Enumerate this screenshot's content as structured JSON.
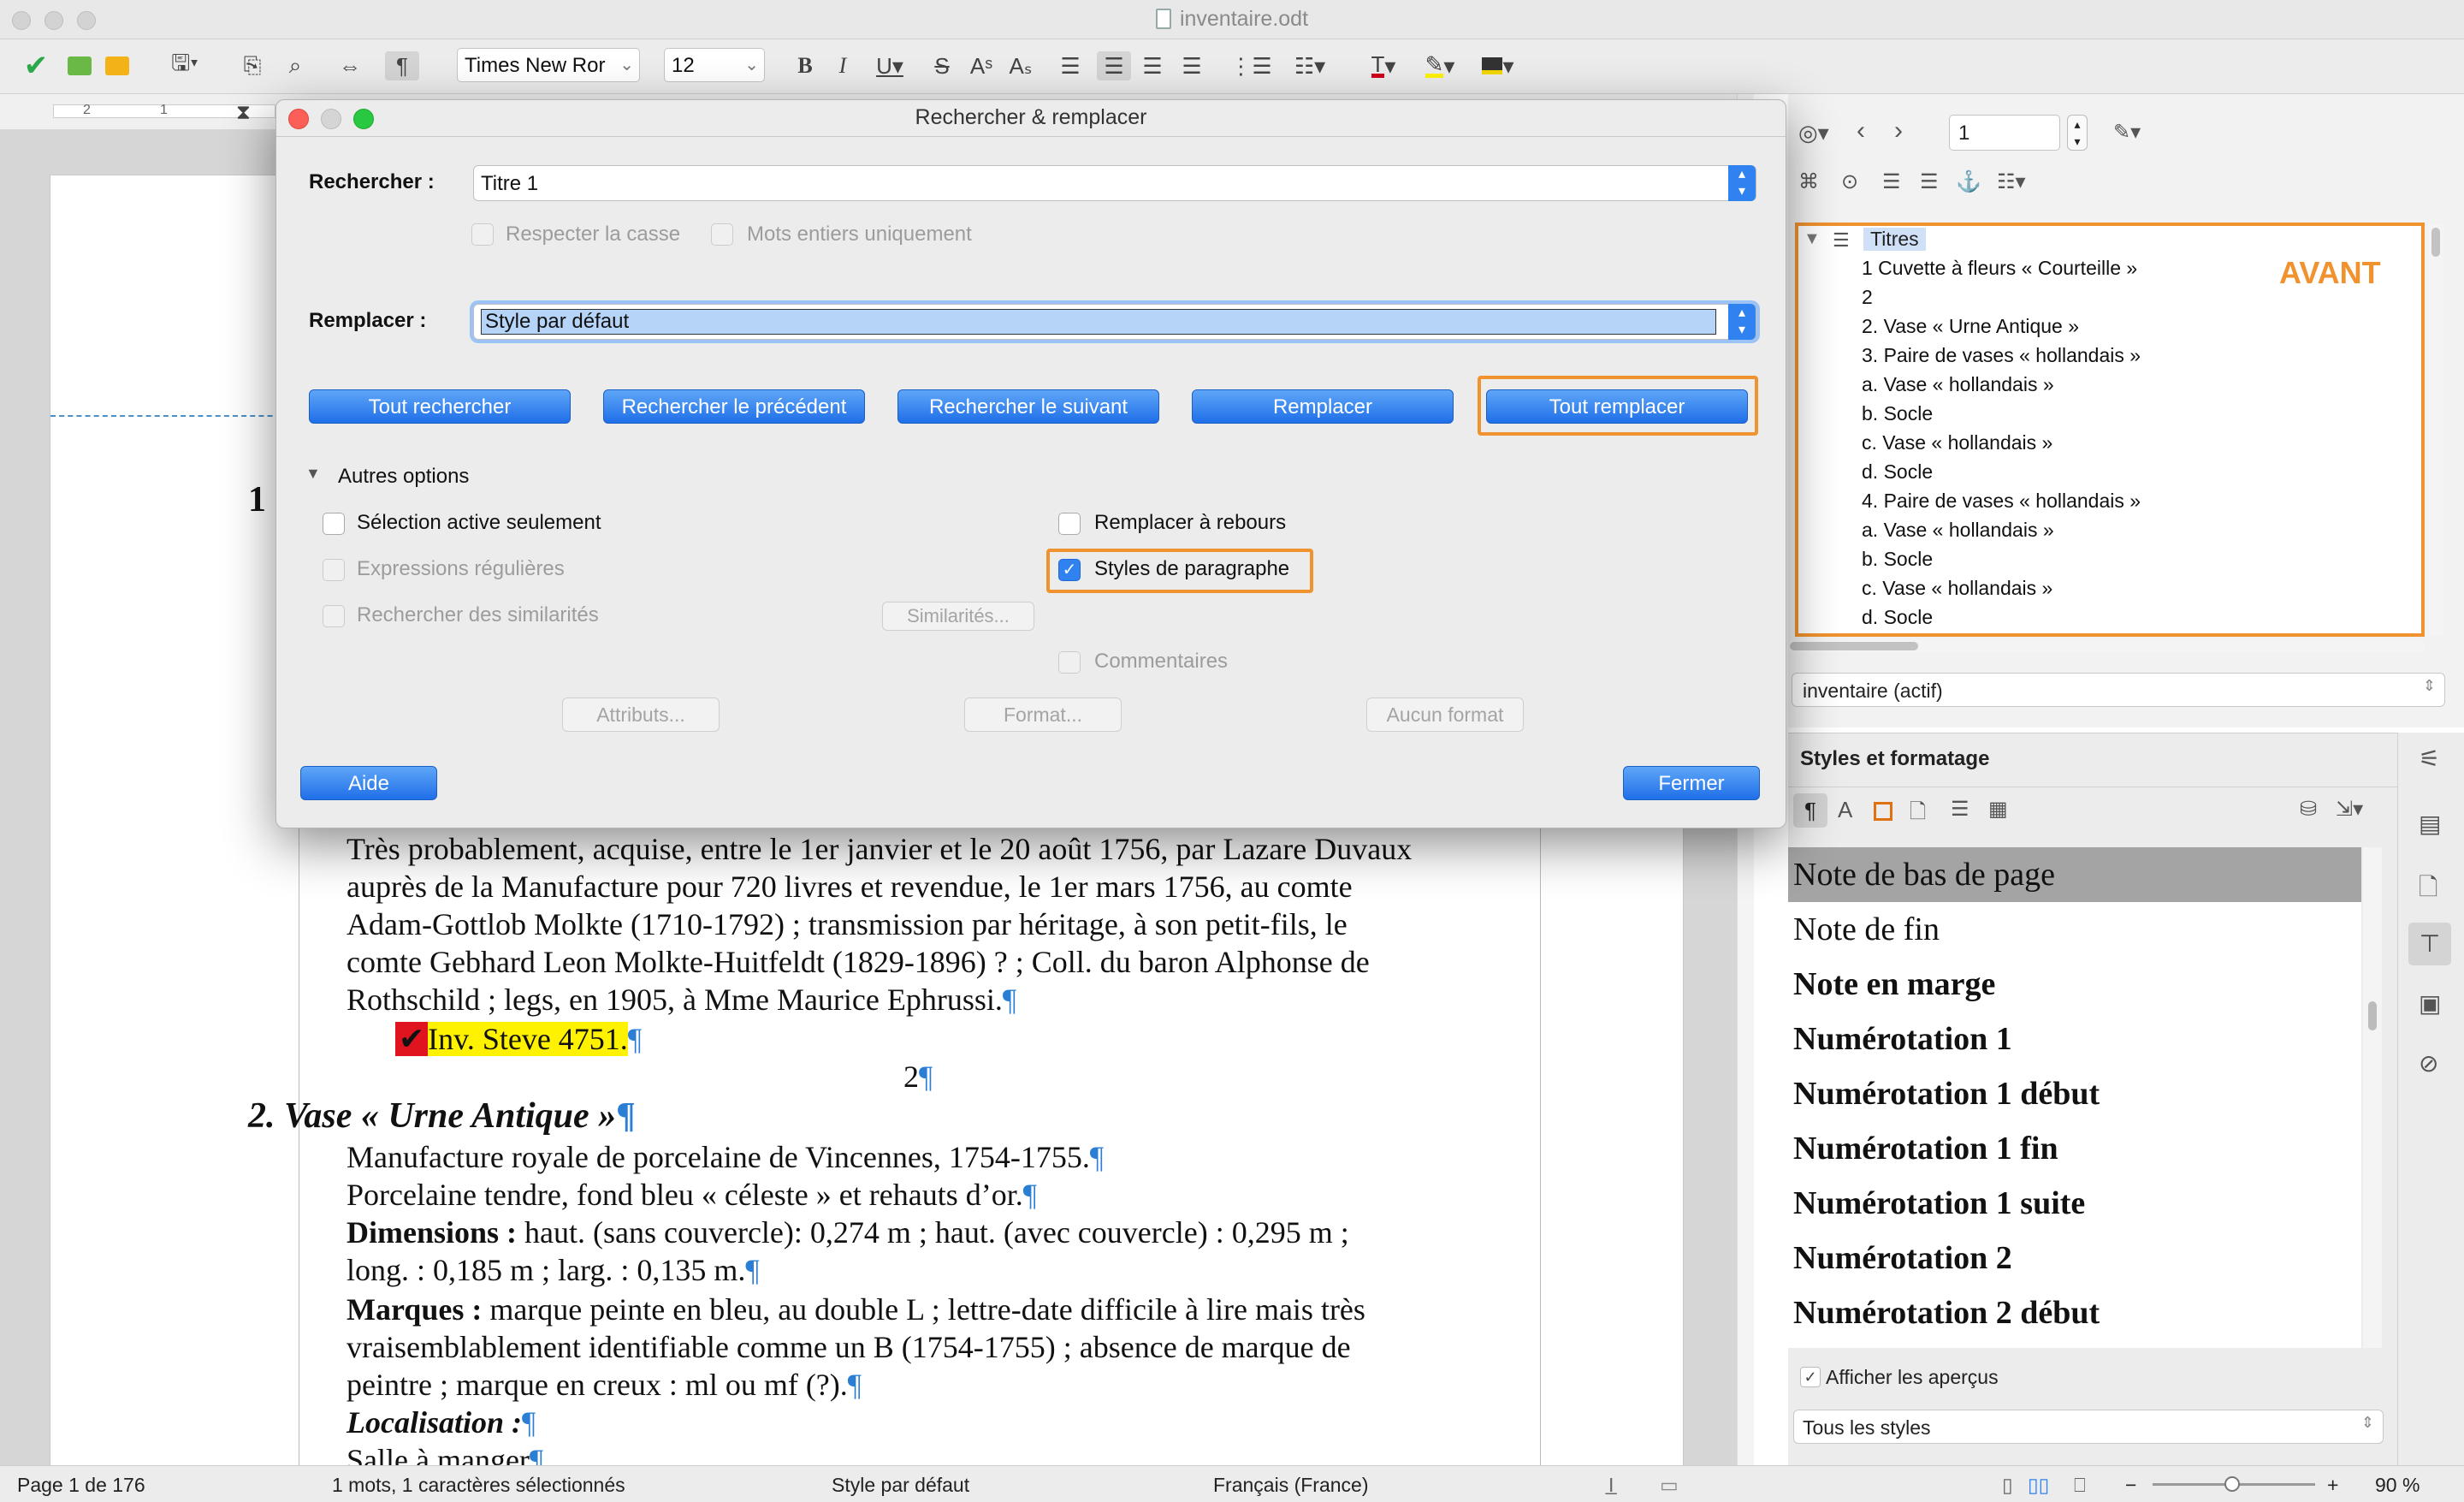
{
  "window": {
    "title": "inventaire.odt"
  },
  "toolbar": {
    "font_name": "Times New Ror",
    "font_size": "12"
  },
  "ruler": {
    "ticks": [
      "2",
      "1"
    ]
  },
  "document": {
    "heading1_number": "1",
    "para_lines": [
      "Très probablement, acquise, entre le 1er janvier et le 20 août 1756, par Lazare Duvaux",
      "auprès de la Manufacture pour 720 livres et revendue, le 1er mars 1756, au comte",
      "Adam-Gottlob Molkte (1710-1792) ; transmission par héritage, à son petit-fils, le",
      "comte Gebhard Leon Molkte-Huitfeldt (1829-1896) ? ; Coll. du baron Alphonse de",
      "Rothschild ; legs, en 1905, à Mme Maurice Ephrussi."
    ],
    "inv_note": "Inv. Steve 4751.",
    "center_number": "2",
    "heading2": "2. Vase « Urne Antique »",
    "lines2": [
      "Manufacture royale de porcelaine de Vincennes, 1754-1755.",
      "Porcelaine tendre, fond bleu « céleste » et rehauts d’or."
    ],
    "dimensions_label": "Dimensions :",
    "dimensions_text": " haut. (sans couvercle): 0,274 m ; haut. (avec couvercle) : 0,295 m ;",
    "dimensions_line2": "long. : 0,185 m ; larg. : 0,135 m.",
    "marques_label": "Marques :",
    "marques_text": " marque peinte en bleu, au double L ; lettre-date difficile à lire mais très",
    "marques_line2": "vraisemblablement identifiable comme un B (1754-1755) ; absence de marque de",
    "marques_line3": "peintre ; marque en creux : ml ou mf (?).",
    "localisation_label": "Localisation :",
    "last_line": "Salle à manger"
  },
  "statusbar": {
    "page": "Page 1 de 176",
    "selection": "1 mots, 1 caractères sélectionnés",
    "style": "Style par défaut",
    "language": "Français (France)",
    "zoom": "90 %"
  },
  "navigator": {
    "page_value": "1",
    "root": "Titres",
    "items": [
      "1 Cuvette à fleurs « Courteille »",
      "2",
      "2. Vase « Urne Antique »",
      "3. Paire de vases « hollandais »",
      "a. Vase « hollandais »",
      "b. Socle",
      "c. Vase « hollandais »",
      "d. Socle",
      "4. Paire de vases « hollandais »",
      "a. Vase « hollandais »",
      "b. Socle",
      "c. Vase « hollandais »",
      "d. Socle"
    ],
    "annotation": "AVANT",
    "document_select": "inventaire (actif)"
  },
  "styles_panel": {
    "title": "Styles et formatage",
    "styles": [
      {
        "name": "Note de bas de page",
        "bold": false,
        "selected": true
      },
      {
        "name": "Note de fin",
        "bold": false,
        "selected": false
      },
      {
        "name": "Note en marge",
        "bold": true,
        "selected": false
      },
      {
        "name": "Numérotation 1",
        "bold": true,
        "selected": false
      },
      {
        "name": "Numérotation 1 début",
        "bold": true,
        "selected": false
      },
      {
        "name": "Numérotation 1 fin",
        "bold": true,
        "selected": false
      },
      {
        "name": "Numérotation 1 suite",
        "bold": true,
        "selected": false
      },
      {
        "name": "Numérotation 2",
        "bold": true,
        "selected": false
      },
      {
        "name": "Numérotation 2 début",
        "bold": true,
        "selected": false
      }
    ],
    "show_previews": "Afficher les aperçus",
    "filter": "Tous les styles"
  },
  "dialog": {
    "title": "Rechercher & remplacer",
    "search_label": "Rechercher :",
    "search_value": "Titre 1",
    "match_case": "Respecter la casse",
    "whole_words": "Mots entiers uniquement",
    "replace_label": "Remplacer :",
    "replace_value": "Style par défaut",
    "btn_find_all": "Tout rechercher",
    "btn_find_prev": "Rechercher le précédent",
    "btn_find_next": "Rechercher le suivant",
    "btn_replace": "Remplacer",
    "btn_replace_all": "Tout remplacer",
    "other_options": "Autres options",
    "current_selection": "Sélection active seulement",
    "regex": "Expressions régulières",
    "similarity": "Rechercher des similarités",
    "similarities_btn": "Similarités...",
    "replace_backwards": "Remplacer à rebours",
    "paragraph_styles": "Styles de paragraphe",
    "comments": "Commentaires",
    "attributes_btn": "Attributs...",
    "format_btn": "Format...",
    "no_format_btn": "Aucun format",
    "help_btn": "Aide",
    "close_btn": "Fermer"
  },
  "colors": {
    "accent": "#2f82f0",
    "annotation": "#f0922e",
    "pilcrow": "#2a7fd4",
    "highlight": "#fff200"
  }
}
